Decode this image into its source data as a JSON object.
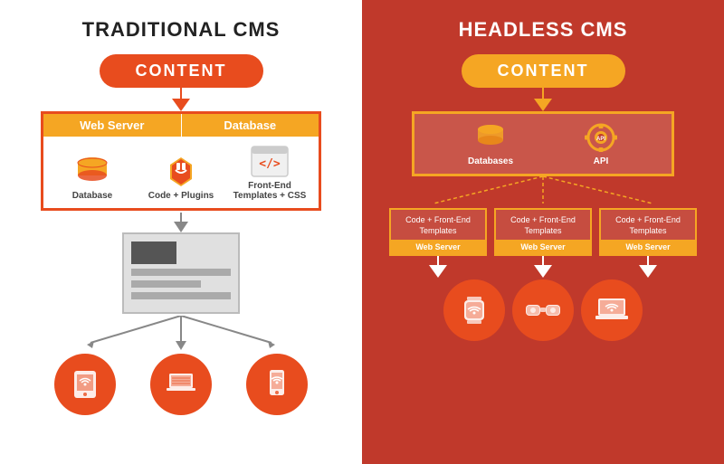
{
  "traditional": {
    "title": "TRADITIONAL CMS",
    "content_label": "CONTENT",
    "web_server_label": "Web Server",
    "database_label": "Database",
    "icons": [
      {
        "name": "Database",
        "type": "database"
      },
      {
        "name": "Code + Plugins",
        "type": "plugins"
      },
      {
        "name": "Front-End Templates + CSS",
        "type": "code"
      }
    ],
    "devices": [
      {
        "type": "tablet"
      },
      {
        "type": "laptop"
      },
      {
        "type": "phone"
      }
    ]
  },
  "headless": {
    "title": "HEADLESS CMS",
    "content_label": "CONTENT",
    "api_icons": [
      {
        "name": "Databases",
        "type": "database"
      },
      {
        "name": "API",
        "type": "api"
      }
    ],
    "servers": [
      {
        "content": "Code + Front-End Templates",
        "label": "Web Server"
      },
      {
        "content": "Code + Front-End Templates",
        "label": "Web Server"
      },
      {
        "content": "Code + Front-End Templates",
        "label": "Web Server"
      }
    ],
    "devices": [
      {
        "type": "watch"
      },
      {
        "type": "glasses"
      },
      {
        "type": "laptop"
      }
    ]
  }
}
